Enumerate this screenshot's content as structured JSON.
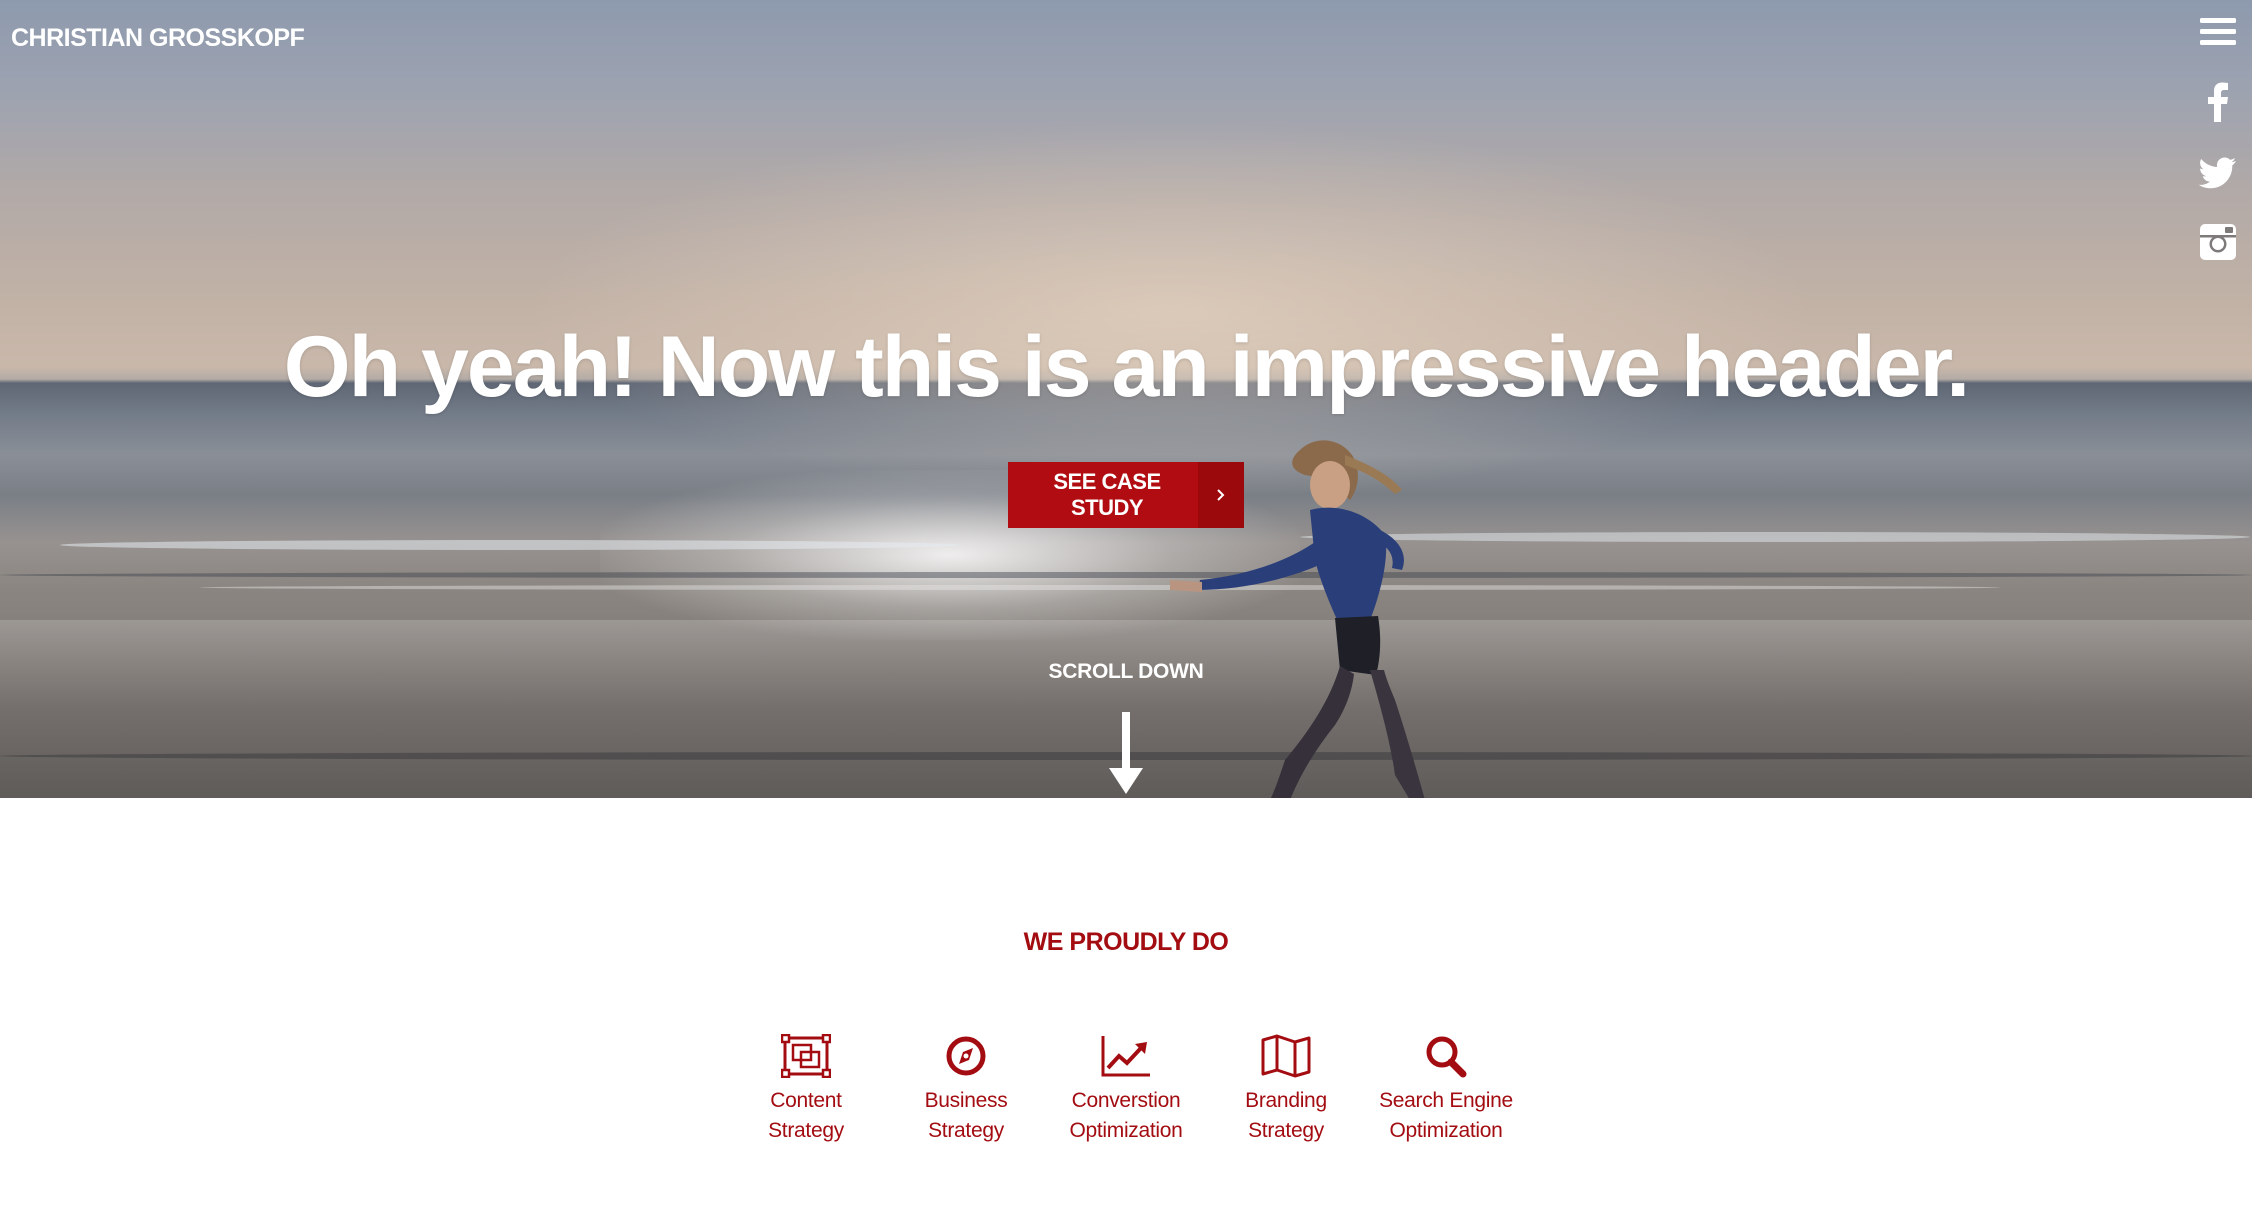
{
  "site": {
    "brand": "CHRISTIAN GROSSKOPF"
  },
  "side_nav": {
    "items": [
      {
        "icon": "menu-icon"
      },
      {
        "icon": "facebook-icon"
      },
      {
        "icon": "twitter-icon"
      },
      {
        "icon": "instagram-icon"
      }
    ]
  },
  "hero": {
    "headline": "Oh yeah! Now this is an impressive header.",
    "cta_label": "SEE CASE STUDY",
    "cta_arrow": "›",
    "scroll_label": "SCROLL DOWN"
  },
  "services": {
    "title": "WE PROUDLY DO",
    "items": [
      {
        "line1": "Content",
        "line2": "Strategy",
        "icon": "content-strategy-icon"
      },
      {
        "line1": "Business",
        "line2": "Strategy",
        "icon": "compass-icon"
      },
      {
        "line1": "Converstion",
        "line2": "Optimization",
        "icon": "line-chart-icon"
      },
      {
        "line1": "Branding",
        "line2": "Strategy",
        "icon": "map-icon"
      },
      {
        "line1": "Search Engine",
        "line2": "Optimization",
        "icon": "search-icon"
      }
    ]
  },
  "colors": {
    "accent": "#b10c11",
    "accent_dark": "#9b090d",
    "service_text": "#a30d12",
    "hero_text": "#ffffff"
  }
}
